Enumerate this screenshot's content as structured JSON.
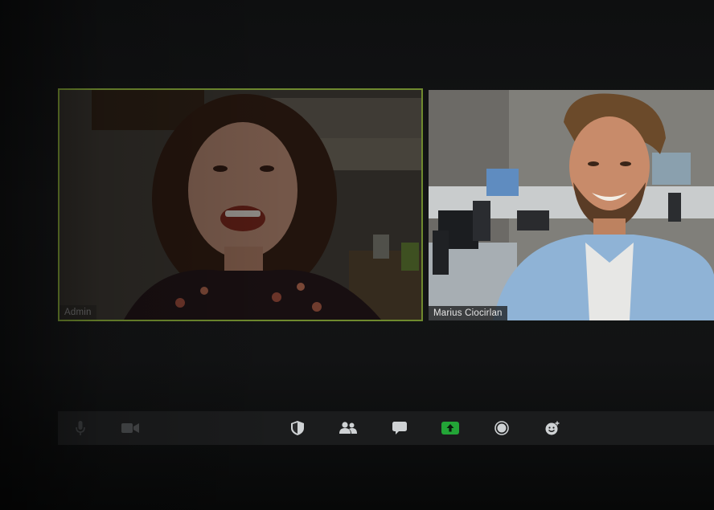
{
  "meeting": {
    "participants": [
      {
        "name": "Admin",
        "active_speaker": true,
        "dimmed": true
      },
      {
        "name": "Marius Ciocirlan",
        "active_speaker": false,
        "dimmed": false
      }
    ]
  },
  "toolbar": {
    "buttons": [
      {
        "icon": "microphone-icon",
        "state": "dimmed"
      },
      {
        "icon": "video-camera-icon",
        "state": "dimmed"
      },
      {
        "icon": "security-shield-icon",
        "state": "normal"
      },
      {
        "icon": "participants-icon",
        "state": "normal"
      },
      {
        "icon": "chat-icon",
        "state": "normal"
      },
      {
        "icon": "share-screen-icon",
        "state": "active"
      },
      {
        "icon": "record-icon",
        "state": "normal"
      },
      {
        "icon": "reactions-icon",
        "state": "normal"
      }
    ]
  },
  "colors": {
    "active_speaker_border": "#6f8a2e",
    "share_green": "#23a537",
    "toolbar_bg": "#1b1c1d",
    "icon_light": "#cfd2d4"
  }
}
